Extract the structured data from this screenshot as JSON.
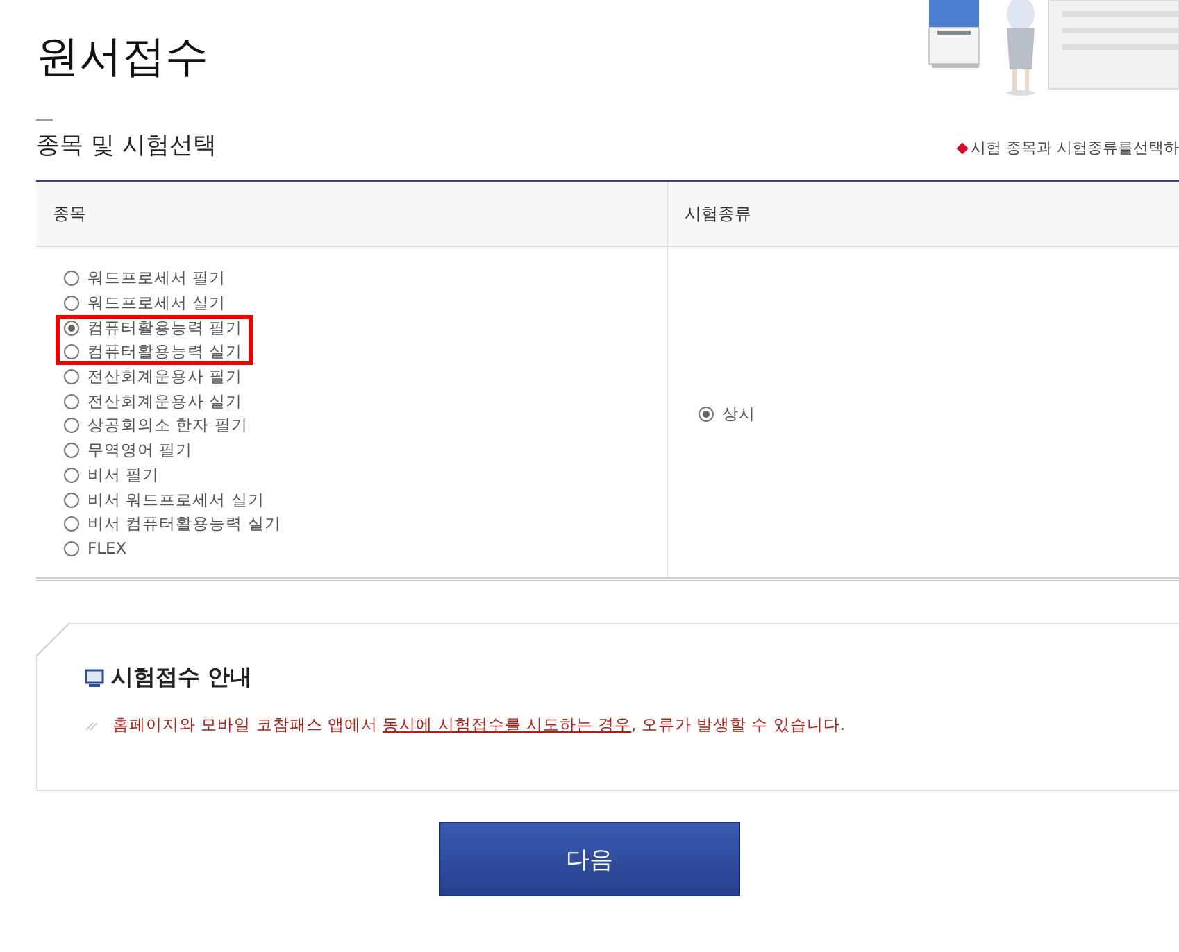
{
  "page_title": "원서접수",
  "section_title": "종목 및 시험선택",
  "hint": "시험 종목과 시험종류를선택하",
  "table": {
    "columns": [
      "종목",
      "시험종류"
    ],
    "subjects": [
      {
        "label": "워드프로세서 필기",
        "selected": false,
        "highlighted": false
      },
      {
        "label": "워드프로세서 실기",
        "selected": false,
        "highlighted": false
      },
      {
        "label": "컴퓨터활용능력 필기",
        "selected": true,
        "highlighted": true
      },
      {
        "label": "컴퓨터활용능력 실기",
        "selected": false,
        "highlighted": true
      },
      {
        "label": "전산회계운용사 필기",
        "selected": false,
        "highlighted": false
      },
      {
        "label": "전산회계운용사 실기",
        "selected": false,
        "highlighted": false
      },
      {
        "label": "상공회의소 한자 필기",
        "selected": false,
        "highlighted": false
      },
      {
        "label": "무역영어 필기",
        "selected": false,
        "highlighted": false
      },
      {
        "label": "비서 필기",
        "selected": false,
        "highlighted": false
      },
      {
        "label": "비서 워드프로세서 실기",
        "selected": false,
        "highlighted": false
      },
      {
        "label": "비서 컴퓨터활용능력 실기",
        "selected": false,
        "highlighted": false
      },
      {
        "label": "FLEX",
        "selected": false,
        "highlighted": false
      }
    ],
    "exam_types": [
      {
        "label": "상시",
        "selected": true
      }
    ]
  },
  "notice": {
    "title": "시험접수 안내",
    "text_before": "홈페이지와 모바일 코참패스 앱에서 ",
    "underlined": "동시에 시험접수를 시도하는 경우",
    "text_after": ", 오류가 발생할 수 있습니다."
  },
  "next_button": "다음"
}
